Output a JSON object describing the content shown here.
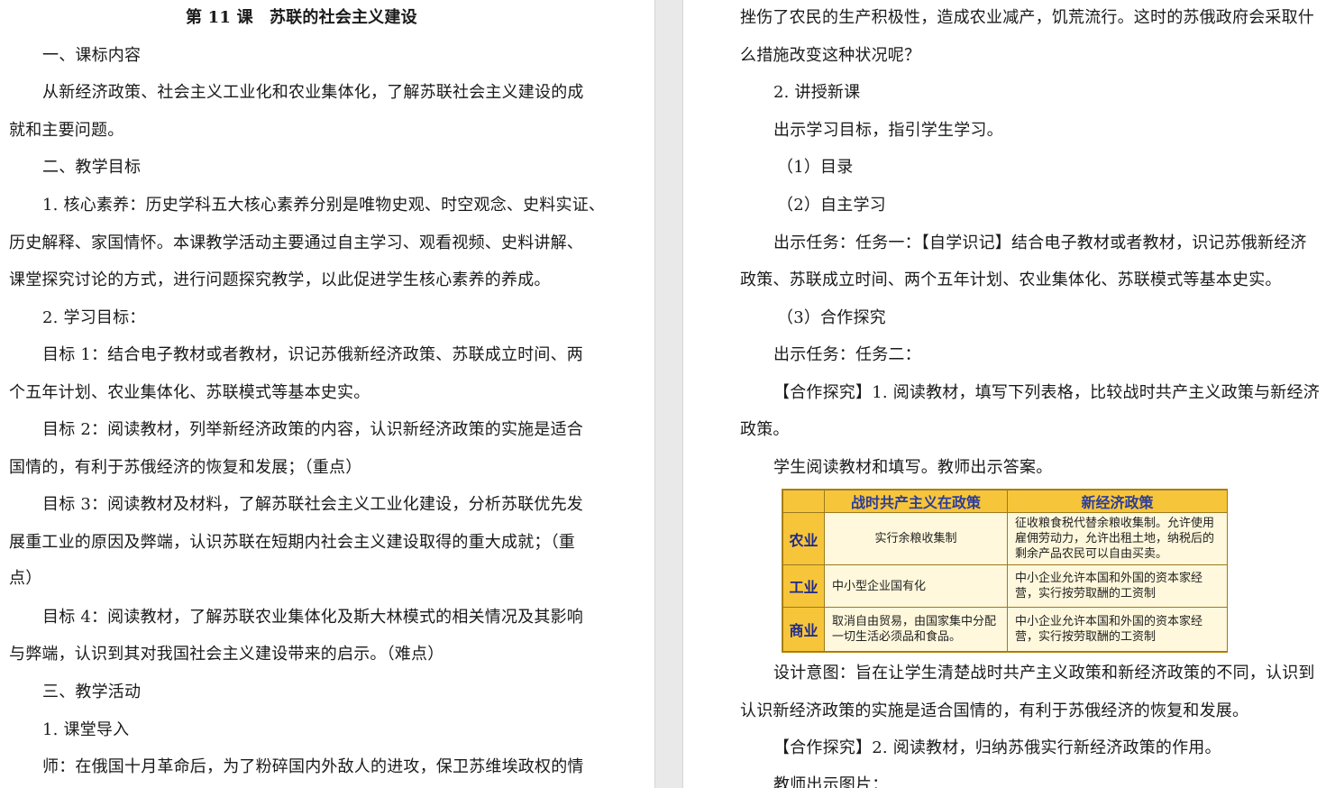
{
  "left_page": {
    "title": "第 11 课　苏联的社会主义建设",
    "lines": [
      "一、课标内容",
      "从新经济政策、社会主义工业化和农业集体化，了解苏联社会主义建设的成",
      "就和主要问题。",
      "二、教学目标",
      "1. 核心素养：历史学科五大核心素养分别是唯物史观、时空观念、史料实证、",
      "历史解释、家国情怀。本课教学活动主要通过自主学习、观看视频、史料讲解、",
      "课堂探究讨论的方式，进行问题探究教学，以此促进学生核心素养的养成。",
      "2. 学习目标：",
      "目标 1：结合电子教材或者教材，识记苏俄新经济政策、苏联成立时间、两",
      "个五年计划、农业集体化、苏联模式等基本史实。",
      "目标 2：阅读教材，列举新经济政策的内容，认识新经济政策的实施是适合",
      "国情的，有利于苏俄经济的恢复和发展；（重点）",
      "目标 3：阅读教材及材料，了解苏联社会主义工业化建设，分析苏联优先发",
      "展重工业的原因及弊端，认识苏联在短期内社会主义建设取得的重大成就；（重",
      "点）",
      "目标 4：阅读教材，了解苏联农业集体化及斯大林模式的相关情况及其影响",
      "与弊端，认识到其对我国社会主义建设带来的启示。（难点）",
      "三、教学活动",
      "1. 课堂导入",
      "师：在俄国十月革命后，为了粉碎国内外敌人的进攻，保卫苏维埃政权的情"
    ]
  },
  "right_page": {
    "lines_top": [
      "挫伤了农民的生产积极性，造成农业减产，饥荒流行。这时的苏俄政府会采取什",
      "么措施改变这种状况呢？",
      "2. 讲授新课",
      "出示学习目标，指引学生学习。",
      "（1）目录",
      "（2）自主学习",
      "出示任务：任务一：【自学识记】结合电子教材或者教材，识记苏俄新经济",
      "政策、苏联成立时间、两个五年计划、农业集体化、苏联模式等基本史实。",
      "（3）合作探究",
      "出示任务：任务二：",
      "【合作探究】1. 阅读教材，填写下列表格，比较战时共产主义政策与新经济",
      "政策。",
      "学生阅读教材和填写。教师出示答案。"
    ],
    "table": {
      "headers": [
        "战时共产主义在政策",
        "新经济政策"
      ],
      "rows": [
        {
          "label": "农业",
          "war": "实行余粮收集制",
          "nep": "征收粮食税代替余粮收集制。允许使用雇佣劳动力，允许出租土地，纳税后的剩余产品农民可以自由买卖。"
        },
        {
          "label": "工业",
          "war": "中小型企业国有化",
          "nep": "中小企业允许本国和外国的资本家经营，实行按劳取酬的工资制"
        },
        {
          "label": "商业",
          "war": "取消自由贸易，由国家集中分配一切生活必须品和食品。",
          "nep": "中小企业允许本国和外国的资本家经营，实行按劳取酬的工资制"
        }
      ]
    },
    "lines_bottom": [
      "设计意图：旨在让学生清楚战时共产主义政策和新经济政策的不同，认识到",
      "认识新经济政策的实施是适合国情的，有利于苏俄经济的恢复和发展。",
      "【合作探究】2. 阅读教材，归纳苏俄实行新经济政策的作用。",
      "教师出示图片："
    ]
  }
}
